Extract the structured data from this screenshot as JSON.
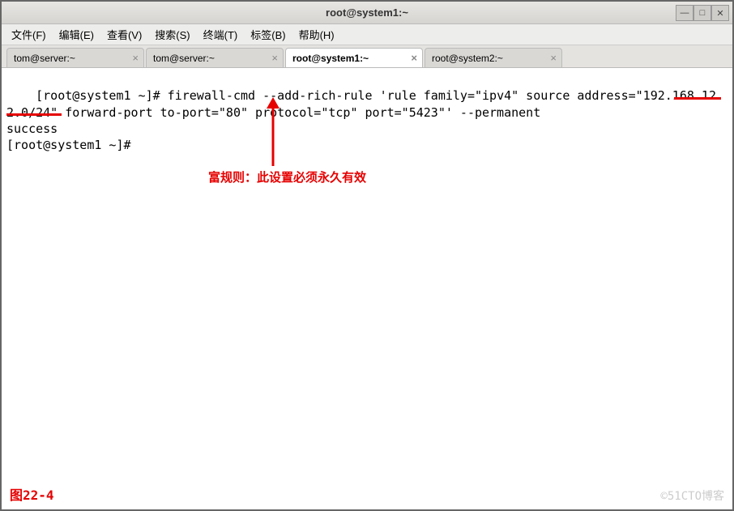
{
  "window": {
    "title": "root@system1:~",
    "min_label": "—",
    "max_label": "□",
    "close_label": "✕"
  },
  "menu": {
    "file": "文件(F)",
    "edit": "编辑(E)",
    "view": "查看(V)",
    "search": "搜索(S)",
    "terminal": "终端(T)",
    "tabs": "标签(B)",
    "help": "帮助(H)"
  },
  "tabs": [
    {
      "label": "tom@server:~",
      "active": false
    },
    {
      "label": "tom@server:~",
      "active": false
    },
    {
      "label": "root@system1:~",
      "active": true
    },
    {
      "label": "root@system2:~",
      "active": false
    }
  ],
  "terminal": {
    "content": "[root@system1 ~]# firewall-cmd --add-rich-rule 'rule family=\"ipv4\" source address=\"192.168.122.0/24\" forward-port to-port=\"80\" protocol=\"tcp\" port=\"5423\"' --permanent\nsuccess\n[root@system1 ~]# "
  },
  "annotations": {
    "note1": "富规则：此设置必须永久有效",
    "figure": "图22-4",
    "watermark": "©51CTO博客"
  }
}
